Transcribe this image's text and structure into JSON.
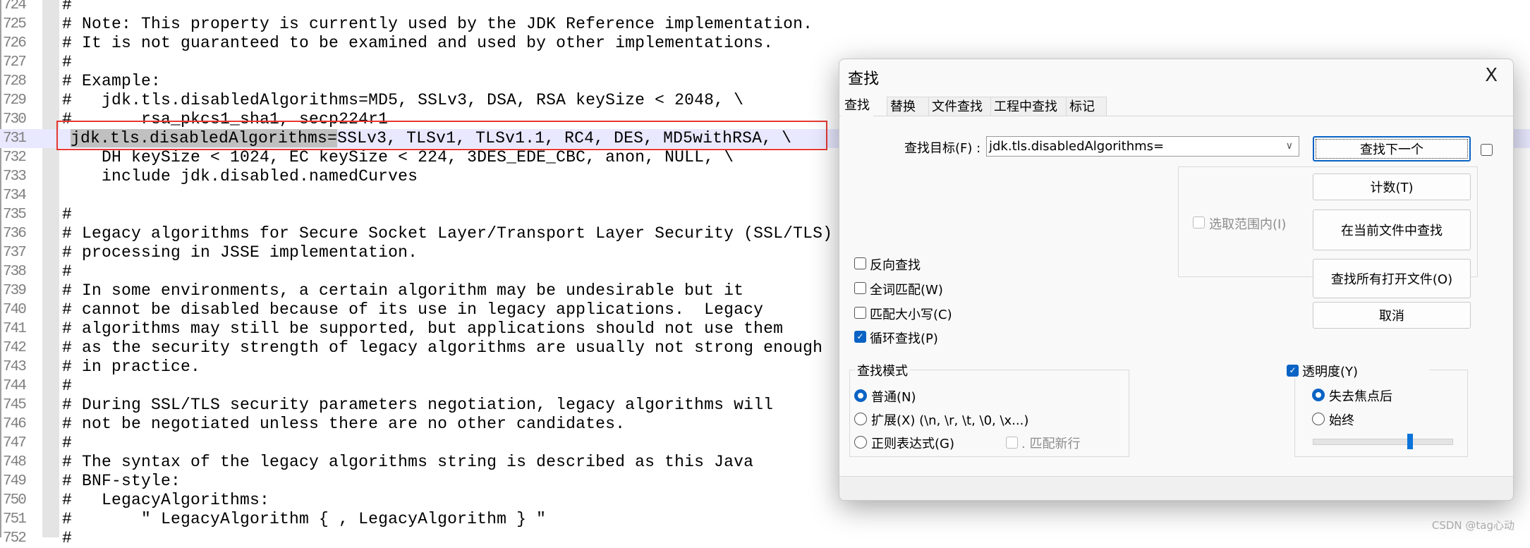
{
  "editor": {
    "highlight_line": "731",
    "lines": [
      {
        "n": "724",
        "t": "#"
      },
      {
        "n": "725",
        "t": "# Note: This property is currently used by the JDK Reference implementation."
      },
      {
        "n": "726",
        "t": "# It is not guaranteed to be examined and used by other implementations."
      },
      {
        "n": "727",
        "t": "#"
      },
      {
        "n": "728",
        "t": "# Example:"
      },
      {
        "n": "729",
        "t": "#   jdk.tls.disabledAlgorithms=MD5, SSLv3, DSA, RSA keySize < 2048, \\"
      },
      {
        "n": "730",
        "t": "#       rsa_pkcs1_sha1, secp224r1"
      },
      {
        "n": "731",
        "sel": "jdk.tls.disabledAlgorithms=",
        "t": "SSLv3, TLSv1, TLSv1.1, RC4, DES, MD5withRSA, \\"
      },
      {
        "n": "732",
        "t": "    DH keySize < 1024, EC keySize < 224, 3DES_EDE_CBC, anon, NULL, \\"
      },
      {
        "n": "733",
        "t": "    include jdk.disabled.namedCurves"
      },
      {
        "n": "734",
        "t": ""
      },
      {
        "n": "735",
        "t": "#"
      },
      {
        "n": "736",
        "t": "# Legacy algorithms for Secure Socket Layer/Transport Layer Security (SSL/TLS)"
      },
      {
        "n": "737",
        "t": "# processing in JSSE implementation."
      },
      {
        "n": "738",
        "t": "#"
      },
      {
        "n": "739",
        "t": "# In some environments, a certain algorithm may be undesirable but it"
      },
      {
        "n": "740",
        "t": "# cannot be disabled because of its use in legacy applications.  Legacy"
      },
      {
        "n": "741",
        "t": "# algorithms may still be supported, but applications should not use them"
      },
      {
        "n": "742",
        "t": "# as the security strength of legacy algorithms are usually not strong enough"
      },
      {
        "n": "743",
        "t": "# in practice."
      },
      {
        "n": "744",
        "t": "#"
      },
      {
        "n": "745",
        "t": "# During SSL/TLS security parameters negotiation, legacy algorithms will"
      },
      {
        "n": "746",
        "t": "# not be negotiated unless there are no other candidates."
      },
      {
        "n": "747",
        "t": "#"
      },
      {
        "n": "748",
        "t": "# The syntax of the legacy algorithms string is described as this Java"
      },
      {
        "n": "749",
        "t": "# BNF-style:"
      },
      {
        "n": "750",
        "t": "#   LegacyAlgorithms:"
      },
      {
        "n": "751",
        "t": "#       \" LegacyAlgorithm { , LegacyAlgorithm } \""
      },
      {
        "n": "752",
        "t": "#"
      }
    ]
  },
  "dialog": {
    "title": "查找",
    "close": "X",
    "tabs": [
      "查找",
      "替换",
      "文件查找",
      "工程中查找",
      "标记"
    ],
    "active_tab": "查找",
    "find_label": "查找目标(F) :",
    "find_value": "jdk.tls.disabledAlgorithms=",
    "buttons": {
      "find_next": "查找下一个",
      "count": "计数(T)",
      "find_in_current": "在当前文件中查找",
      "find_all_open": "查找所有打开文件(O)",
      "cancel": "取消"
    },
    "in_selection": {
      "label": "选取范围内(I)",
      "checked": false,
      "enabled": false
    },
    "options": [
      {
        "label": "反向查找",
        "checked": false
      },
      {
        "label": "全词匹配(W)",
        "checked": false
      },
      {
        "label": "匹配大小写(C)",
        "checked": false
      },
      {
        "label": "循环查找(P)",
        "checked": true
      }
    ],
    "search_mode": {
      "title": "查找模式",
      "modes": [
        {
          "label": "普通(N)",
          "selected": true
        },
        {
          "label": "扩展(X) (\\n, \\r, \\t, \\0, \\x...)",
          "selected": false
        },
        {
          "label": "正则表达式(G)",
          "selected": false
        }
      ],
      "dot_newline": {
        "label": ". 匹配新行",
        "checked": false,
        "enabled": false
      }
    },
    "transparency": {
      "label": "透明度(Y)",
      "checked": true,
      "modes": [
        {
          "label": "失去焦点后",
          "selected": true
        },
        {
          "label": "始终",
          "selected": false
        }
      ],
      "slider_percent": 70
    }
  },
  "watermark": "CSDN @tag心动",
  "colors": {
    "accent": "#0a63c4",
    "line_highlight": "#e8e8ff",
    "selection": "#c0c0c0",
    "annotation_box": "#e53935"
  }
}
